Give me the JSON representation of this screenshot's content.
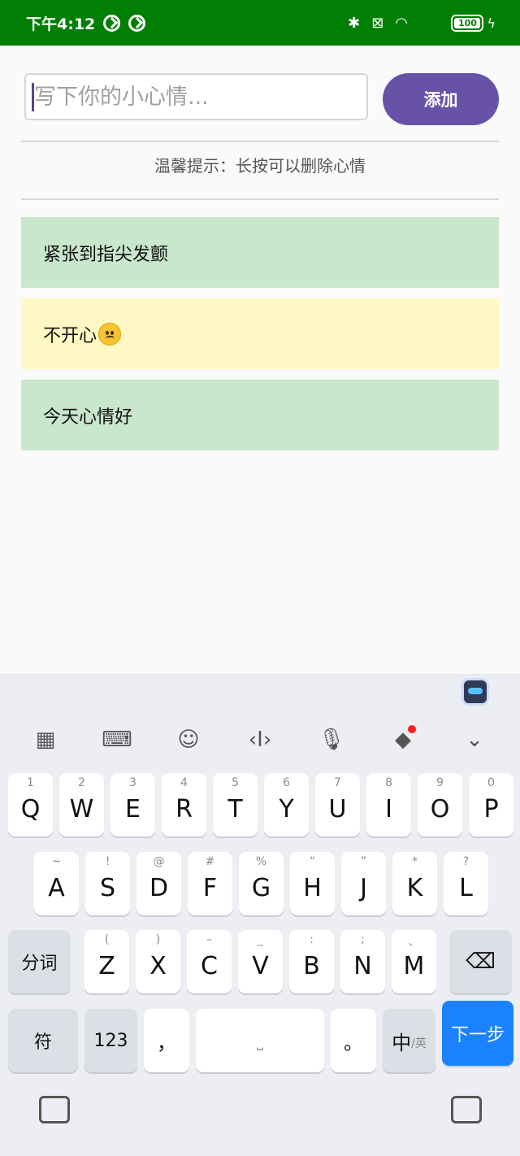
{
  "status_bar": {
    "time": "下午4:12",
    "battery": "100"
  },
  "input": {
    "placeholder": "写下你的小心情..."
  },
  "add_button_label": "添加",
  "tip": "温馨提示：长按可以删除心情",
  "moods": [
    {
      "text": "紧张到指尖发颤",
      "color": "#c9e7cc",
      "emoji": false
    },
    {
      "text": "不开心",
      "color": "#fff8c4",
      "emoji": true
    },
    {
      "text": "今天心情好",
      "color": "#c9e7cc",
      "emoji": false
    }
  ],
  "keyboard": {
    "row1": [
      {
        "hint": "1",
        "key": "Q"
      },
      {
        "hint": "2",
        "key": "W"
      },
      {
        "hint": "3",
        "key": "E"
      },
      {
        "hint": "4",
        "key": "R"
      },
      {
        "hint": "5",
        "key": "T"
      },
      {
        "hint": "6",
        "key": "Y"
      },
      {
        "hint": "7",
        "key": "U"
      },
      {
        "hint": "8",
        "key": "I"
      },
      {
        "hint": "9",
        "key": "O"
      },
      {
        "hint": "0",
        "key": "P"
      }
    ],
    "row2": [
      {
        "hint": "~",
        "key": "A"
      },
      {
        "hint": "!",
        "key": "S"
      },
      {
        "hint": "@",
        "key": "D"
      },
      {
        "hint": "#",
        "key": "F"
      },
      {
        "hint": "%",
        "key": "G"
      },
      {
        "hint": "“",
        "key": "H"
      },
      {
        "hint": "”",
        "key": "J"
      },
      {
        "hint": "*",
        "key": "K"
      },
      {
        "hint": "?",
        "key": "L"
      }
    ],
    "row3": [
      {
        "hint": "(",
        "key": "Z"
      },
      {
        "hint": ")",
        "key": "X"
      },
      {
        "hint": "–",
        "key": "C"
      },
      {
        "hint": "_",
        "key": "V"
      },
      {
        "hint": ":",
        "key": "B"
      },
      {
        "hint": ";",
        "key": "N"
      },
      {
        "hint": "、",
        "key": "M"
      }
    ],
    "segment_label": "分词",
    "symbol_label": "符",
    "numeric_label": "123",
    "comma_label": "，",
    "period_label": "。",
    "lang_main": "中",
    "lang_sub": "/英",
    "next_label": "下一步"
  }
}
